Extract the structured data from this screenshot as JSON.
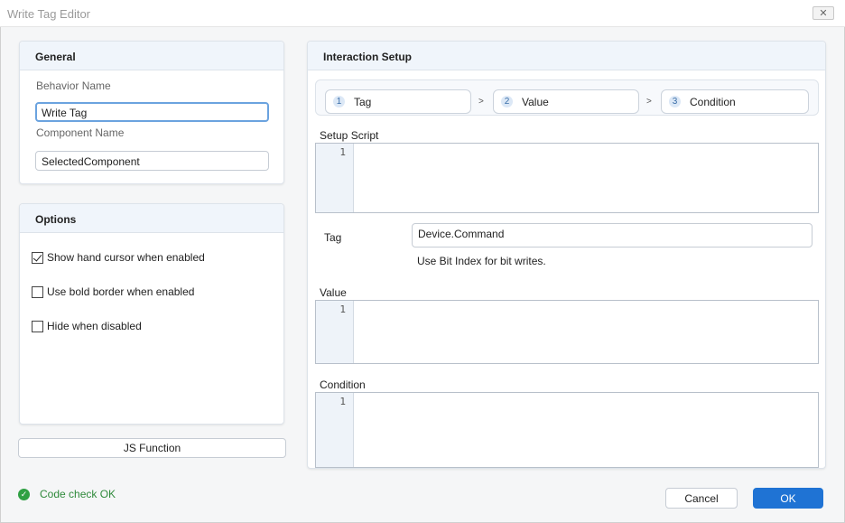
{
  "window": {
    "title": "Write Tag Editor"
  },
  "general": {
    "header": "General",
    "behavior_name_label": "Behavior Name",
    "behavior_name_value": "Write Tag",
    "component_name_label": "Component Name",
    "component_name_value": "SelectedComponent"
  },
  "options": {
    "header": "Options",
    "items": [
      {
        "label": "Show hand cursor when enabled",
        "checked": true
      },
      {
        "label": "Use bold border when enabled",
        "checked": false
      },
      {
        "label": "Hide when disabled",
        "checked": false
      }
    ]
  },
  "js_function_label": "JS Function",
  "interaction": {
    "header": "Interaction Setup",
    "steps": [
      {
        "num": "1",
        "label": "Tag"
      },
      {
        "num": "2",
        "label": "Value"
      },
      {
        "num": "3",
        "label": "Condition"
      }
    ],
    "separator": ">",
    "setup_script_label": "Setup Script",
    "setup_script_line": "1",
    "tag_label": "Tag",
    "tag_value": "Device.Command",
    "tag_hint": "Use Bit Index for bit writes.",
    "value_label": "Value",
    "value_line": "1",
    "condition_label": "Condition",
    "condition_line": "1"
  },
  "status": {
    "text": "Code check OK",
    "icon": "check-circle-icon",
    "color": "#2fa043"
  },
  "footer": {
    "cancel_label": "Cancel",
    "ok_label": "OK",
    "accent": "#1f73d4"
  }
}
